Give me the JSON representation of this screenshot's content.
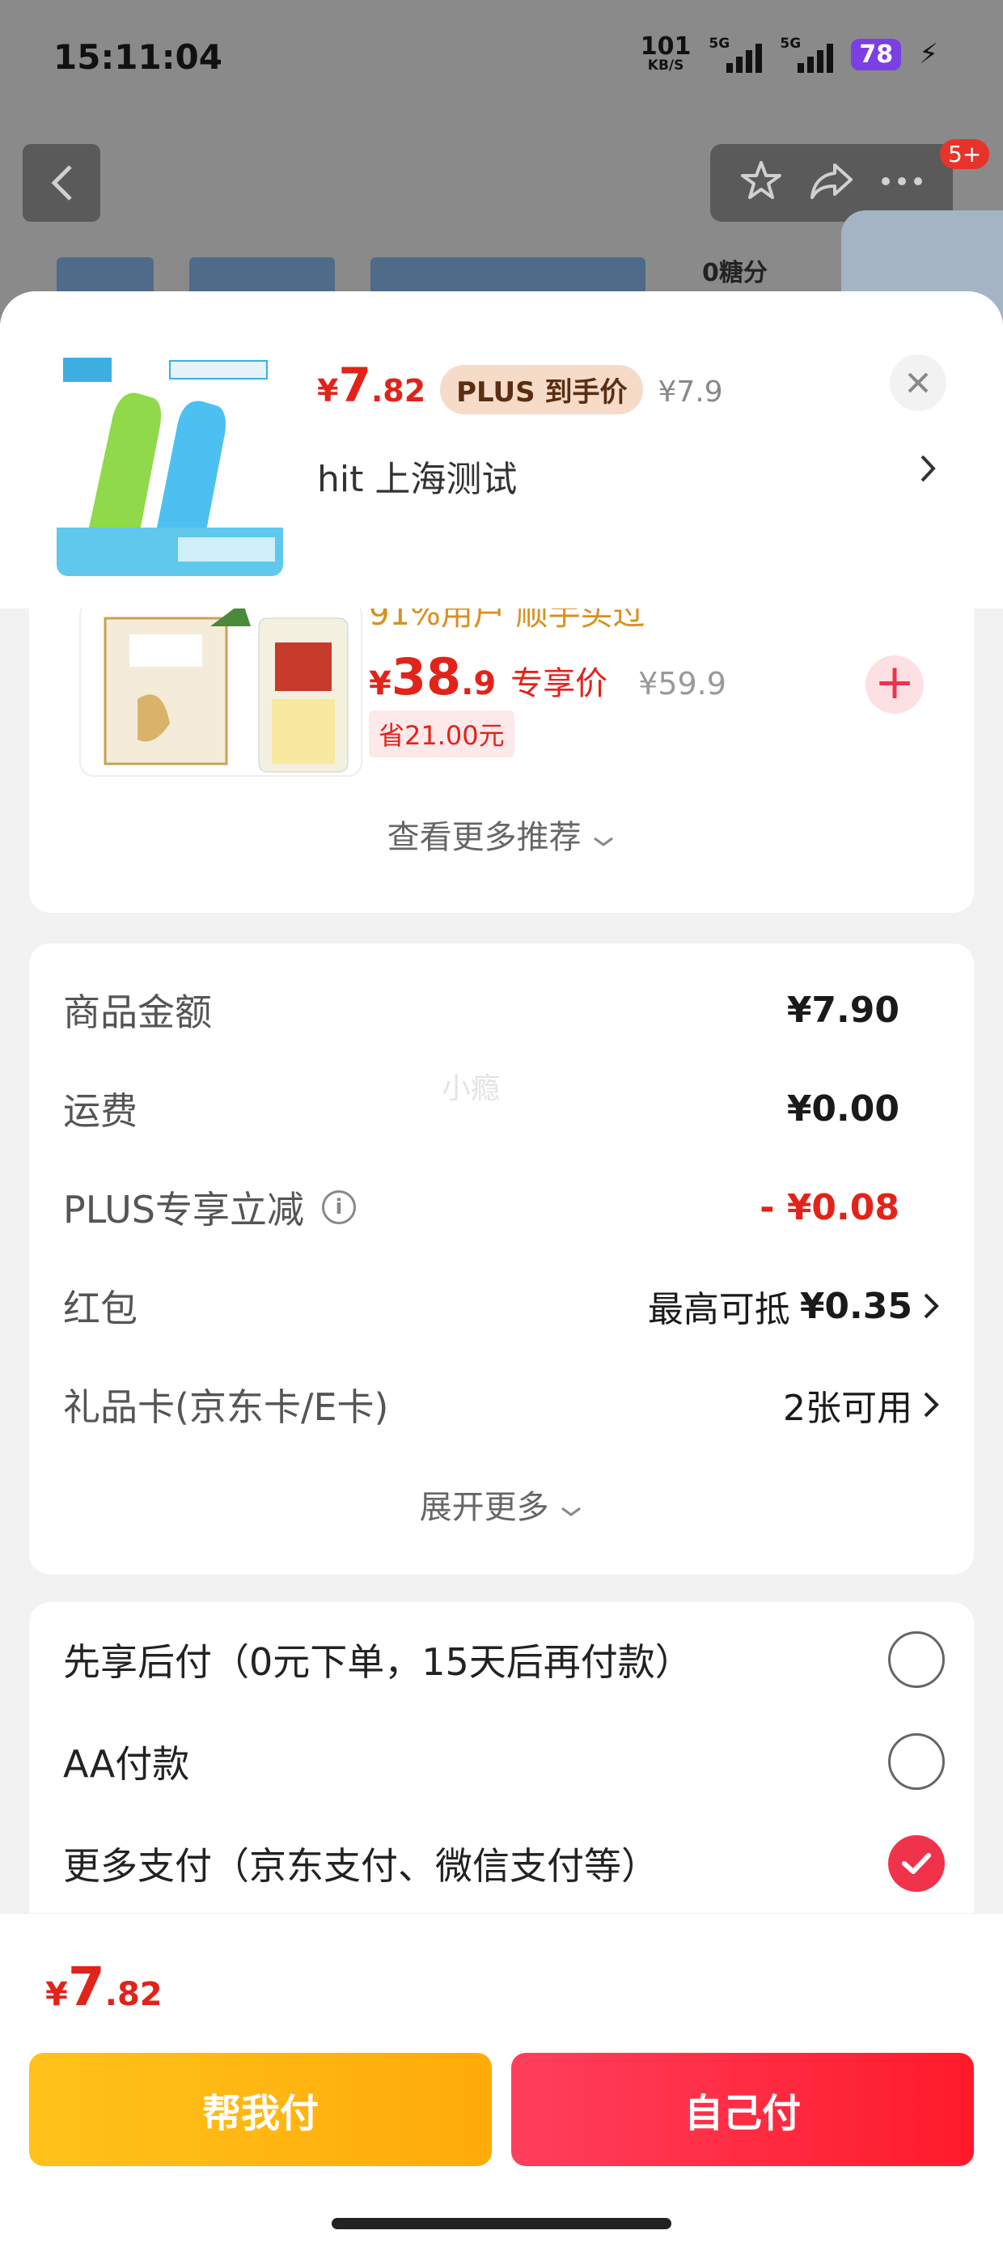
{
  "status_bar": {
    "time": "15:11:04",
    "net_speed_value": "101",
    "net_speed_unit": "KB/S",
    "sim1_label": "5G",
    "sim2_label": "5G",
    "battery": "78"
  },
  "background": {
    "badge": "5+",
    "sugar_text": "0糖分"
  },
  "product": {
    "price_currency": "¥",
    "price_int": "7",
    "price_dec": ".82",
    "plus_tag": "PLUS 到手价",
    "original_price": "¥7.9",
    "address": "hit  上海测试"
  },
  "recommendation": {
    "title": "91%用户 顺手买过",
    "price_currency": "¥",
    "price_int": "38",
    "price_dec": ".9",
    "price_tag": "专享价",
    "original_price": "¥59.9",
    "save_label": "省21.00元",
    "more_label": "查看更多推荐"
  },
  "fees": {
    "watermark": "小瘾",
    "rows": [
      {
        "label": "商品金额",
        "value": "¥7.90"
      },
      {
        "label": "运费",
        "value": "¥0.00"
      },
      {
        "label": "PLUS专享立减",
        "value": "- ¥0.08"
      },
      {
        "label": "红包",
        "value_prefix": "最高可抵",
        "value": "¥0.35"
      },
      {
        "label": "礼品卡(京东卡/E卡)",
        "value": "2张可用"
      }
    ],
    "expand_label": "展开更多"
  },
  "payment": {
    "options": [
      {
        "label": "先享后付（0元下单，15天后再付款）",
        "selected": false
      },
      {
        "label": "AA付款",
        "selected": false
      },
      {
        "label": "更多支付（京东支付、微信支付等）",
        "selected": true
      }
    ]
  },
  "footer": {
    "total_currency": "¥",
    "total_int": "7",
    "total_dec": ".82",
    "help_pay_label": "帮我付",
    "self_pay_label": "自己付"
  },
  "colors": {
    "accent_red": "#e2231a",
    "help_button": "#ffb80f",
    "self_button": "#ff2a3c"
  }
}
